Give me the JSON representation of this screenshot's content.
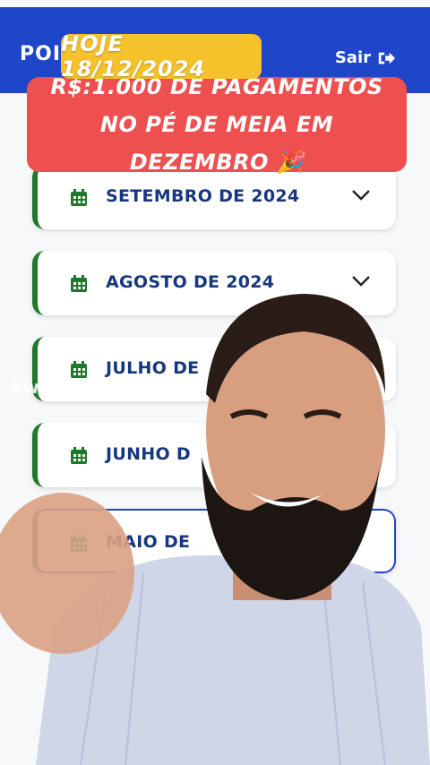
{
  "app": {
    "brand_partial": "POI",
    "logout_label": "Sair"
  },
  "captions": {
    "date": "HOJE 18/12/2024",
    "headline": "R$:1.000 DE PAGAMENTOS NO PÉ DE MEIA EM DEZEMBRO 🎉"
  },
  "months": [
    {
      "label": "SETEMBRO DE 2024"
    },
    {
      "label": "AGOSTO DE 2024"
    },
    {
      "label": "JULHO DE"
    },
    {
      "label": "JUNHO D"
    },
    {
      "label": "MAIO DE"
    }
  ],
  "watermark": "kwai",
  "colors": {
    "header_blue": "#1f45c9",
    "accent_green": "#1e7a2a",
    "label_navy": "#17377e",
    "caption_yellow": "#f5c22c",
    "caption_red": "#ee4f4f"
  }
}
